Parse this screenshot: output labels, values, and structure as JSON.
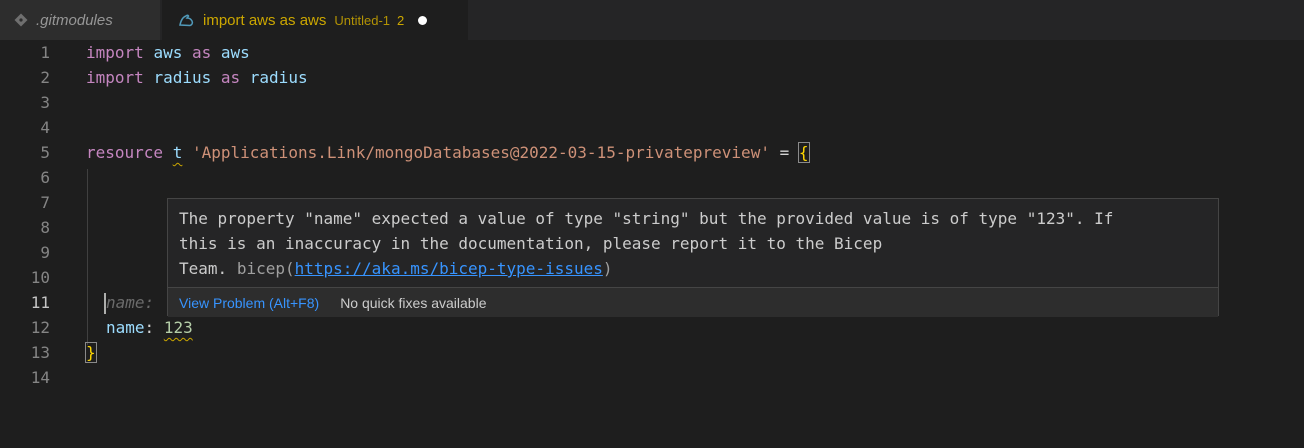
{
  "tabs": [
    {
      "label": ".gitmodules",
      "icon": "git-icon"
    },
    {
      "label": "import aws as aws",
      "description": "Untitled-1",
      "problem_count": "2",
      "icon": "bicep-icon",
      "dirty": true
    }
  ],
  "editor": {
    "line_numbers": [
      "1",
      "2",
      "3",
      "4",
      "5",
      "6",
      "7",
      "8",
      "9",
      "10",
      "11",
      "12",
      "13",
      "14"
    ],
    "current_line": "11",
    "code": {
      "l1": {
        "kw": "import",
        "name": "aws",
        "as": "as",
        "alias": "aws"
      },
      "l2": {
        "kw": "import",
        "name": "radius",
        "as": "as",
        "alias": "radius"
      },
      "l5": {
        "kw": "resource",
        "name": "t",
        "type": "'Applications.Link/mongoDatabases@2022-03-15-privatepreview'",
        "eq": "=",
        "brace": "{"
      },
      "l11": {
        "ghost": "name:"
      },
      "l12": {
        "prop": "name",
        "colon": ":",
        "value": "123"
      },
      "l13": {
        "brace": "}"
      }
    }
  },
  "hover": {
    "message_line1": "The property \"name\" expected a value of type \"string\" but the provided value is of type \"123\". If",
    "message_line2": "this is an inaccuracy in the documentation, please report it to the Bicep",
    "message_line3": "Team.",
    "source": "bicep(",
    "link": "https://aka.ms/bicep-type-issues",
    "source_close": ")",
    "view_problem": "View Problem (Alt+F8)",
    "no_quick_fixes": "No quick fixes available"
  }
}
